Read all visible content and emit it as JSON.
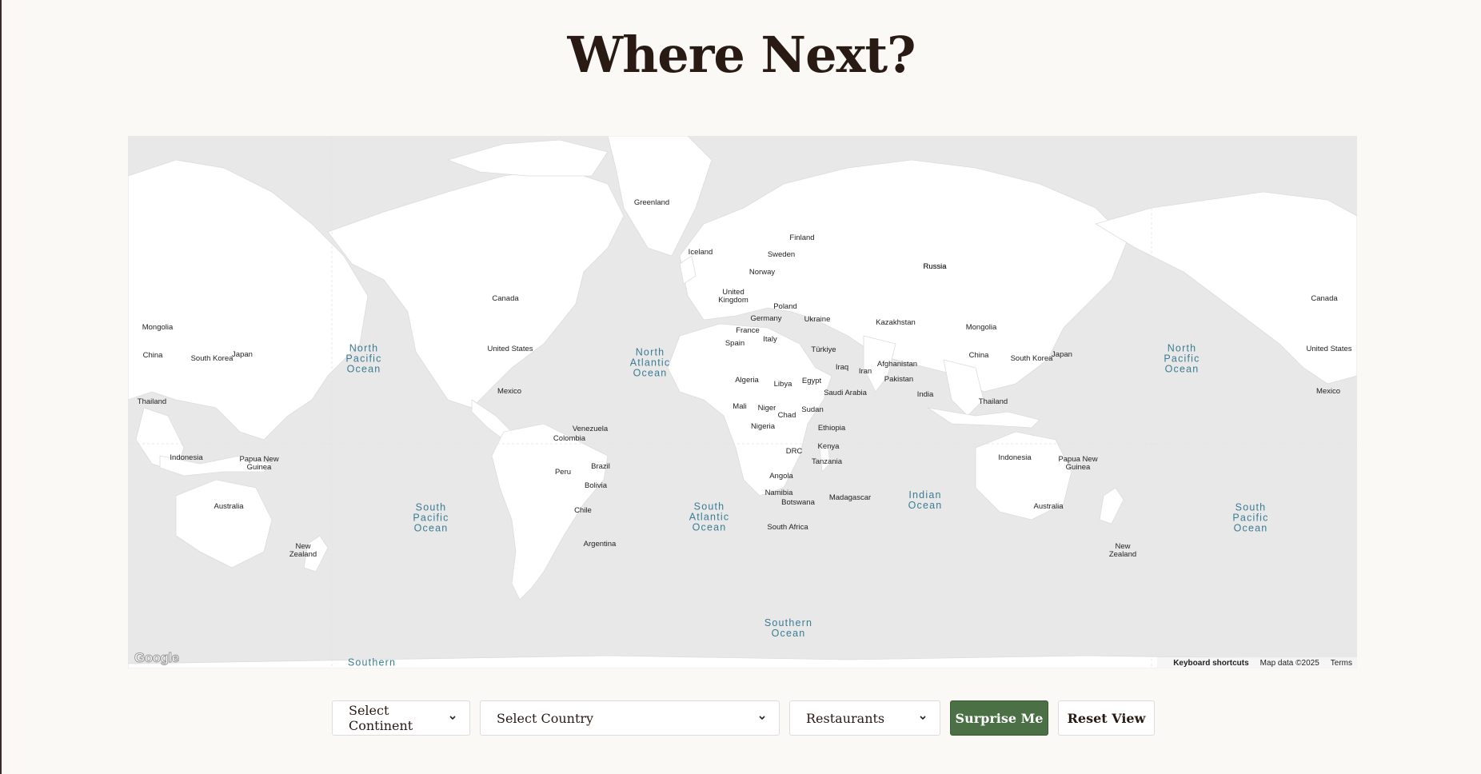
{
  "page": {
    "title": "Where Next?"
  },
  "map": {
    "country_labels": [
      {
        "text": "Greenland"
      },
      {
        "text": "Iceland"
      },
      {
        "text": "Finland"
      },
      {
        "text": "Sweden"
      },
      {
        "text": "Norway"
      },
      {
        "text": "United\nKingdom"
      },
      {
        "text": "Poland"
      },
      {
        "text": "Germany"
      },
      {
        "text": "Ukraine"
      },
      {
        "text": "France"
      },
      {
        "text": "Italy"
      },
      {
        "text": "Spain"
      },
      {
        "text": "Kazakhstan"
      },
      {
        "text": "Russia"
      },
      {
        "text": "Mongolia"
      },
      {
        "text": "China"
      },
      {
        "text": "South Korea"
      },
      {
        "text": "Japan"
      },
      {
        "text": "Türkiye"
      },
      {
        "text": "Afghanistan"
      },
      {
        "text": "Iraq"
      },
      {
        "text": "Iran"
      },
      {
        "text": "Pakistan"
      },
      {
        "text": "India"
      },
      {
        "text": "Thailand"
      },
      {
        "text": "Algeria"
      },
      {
        "text": "Libya"
      },
      {
        "text": "Egypt"
      },
      {
        "text": "Saudi Arabia"
      },
      {
        "text": "Mali"
      },
      {
        "text": "Niger"
      },
      {
        "text": "Chad"
      },
      {
        "text": "Sudan"
      },
      {
        "text": "Nigeria"
      },
      {
        "text": "Ethiopia"
      },
      {
        "text": "Kenya"
      },
      {
        "text": "DRC"
      },
      {
        "text": "Tanzania"
      },
      {
        "text": "Angola"
      },
      {
        "text": "Namibia"
      },
      {
        "text": "Botswana"
      },
      {
        "text": "Madagascar"
      },
      {
        "text": "South Africa"
      },
      {
        "text": "Canada"
      },
      {
        "text": "United States"
      },
      {
        "text": "Mexico"
      },
      {
        "text": "Venezuela"
      },
      {
        "text": "Colombia"
      },
      {
        "text": "Peru"
      },
      {
        "text": "Brazil"
      },
      {
        "text": "Bolivia"
      },
      {
        "text": "Chile"
      },
      {
        "text": "Argentina"
      },
      {
        "text": "Indonesia"
      },
      {
        "text": "Papua New\nGuinea"
      },
      {
        "text": "Australia"
      },
      {
        "text": "New\nZealand"
      },
      {
        "text": "Russia"
      },
      {
        "text": "Mongolia"
      },
      {
        "text": "China"
      },
      {
        "text": "South Korea"
      },
      {
        "text": "Japan"
      },
      {
        "text": "Thailand"
      },
      {
        "text": "Indonesia"
      },
      {
        "text": "Papua New\nGuinea"
      },
      {
        "text": "Australia"
      },
      {
        "text": "New\nZealand"
      },
      {
        "text": "Canada"
      },
      {
        "text": "United States"
      },
      {
        "text": "Mexico"
      }
    ],
    "ocean_labels": [
      {
        "text": "North\nPacific\nOcean"
      },
      {
        "text": "North\nAtlantic\nOcean"
      },
      {
        "text": "South\nPacific\nOcean"
      },
      {
        "text": "South\nAtlantic\nOcean"
      },
      {
        "text": "Indian\nOcean"
      },
      {
        "text": "Southern\nOcean"
      },
      {
        "text": "North\nPacific\nOcean"
      },
      {
        "text": "South\nPacific\nOcean"
      },
      {
        "text": "Southern"
      }
    ],
    "logo_text": "Google",
    "keyboard_shortcuts": "Keyboard shortcuts",
    "map_data": "Map data ©2025",
    "terms": "Terms",
    "colors": {
      "water": "#e8e8e8",
      "land": "#ffffff",
      "ocean_label": "#3a7c93"
    }
  },
  "controls": {
    "continent_select": "Select Continent",
    "country_select": "Select Country",
    "category_select": "Restaurants",
    "surprise_button": "Surprise Me",
    "reset_button": "Reset View",
    "accent_color": "#4b7045"
  }
}
